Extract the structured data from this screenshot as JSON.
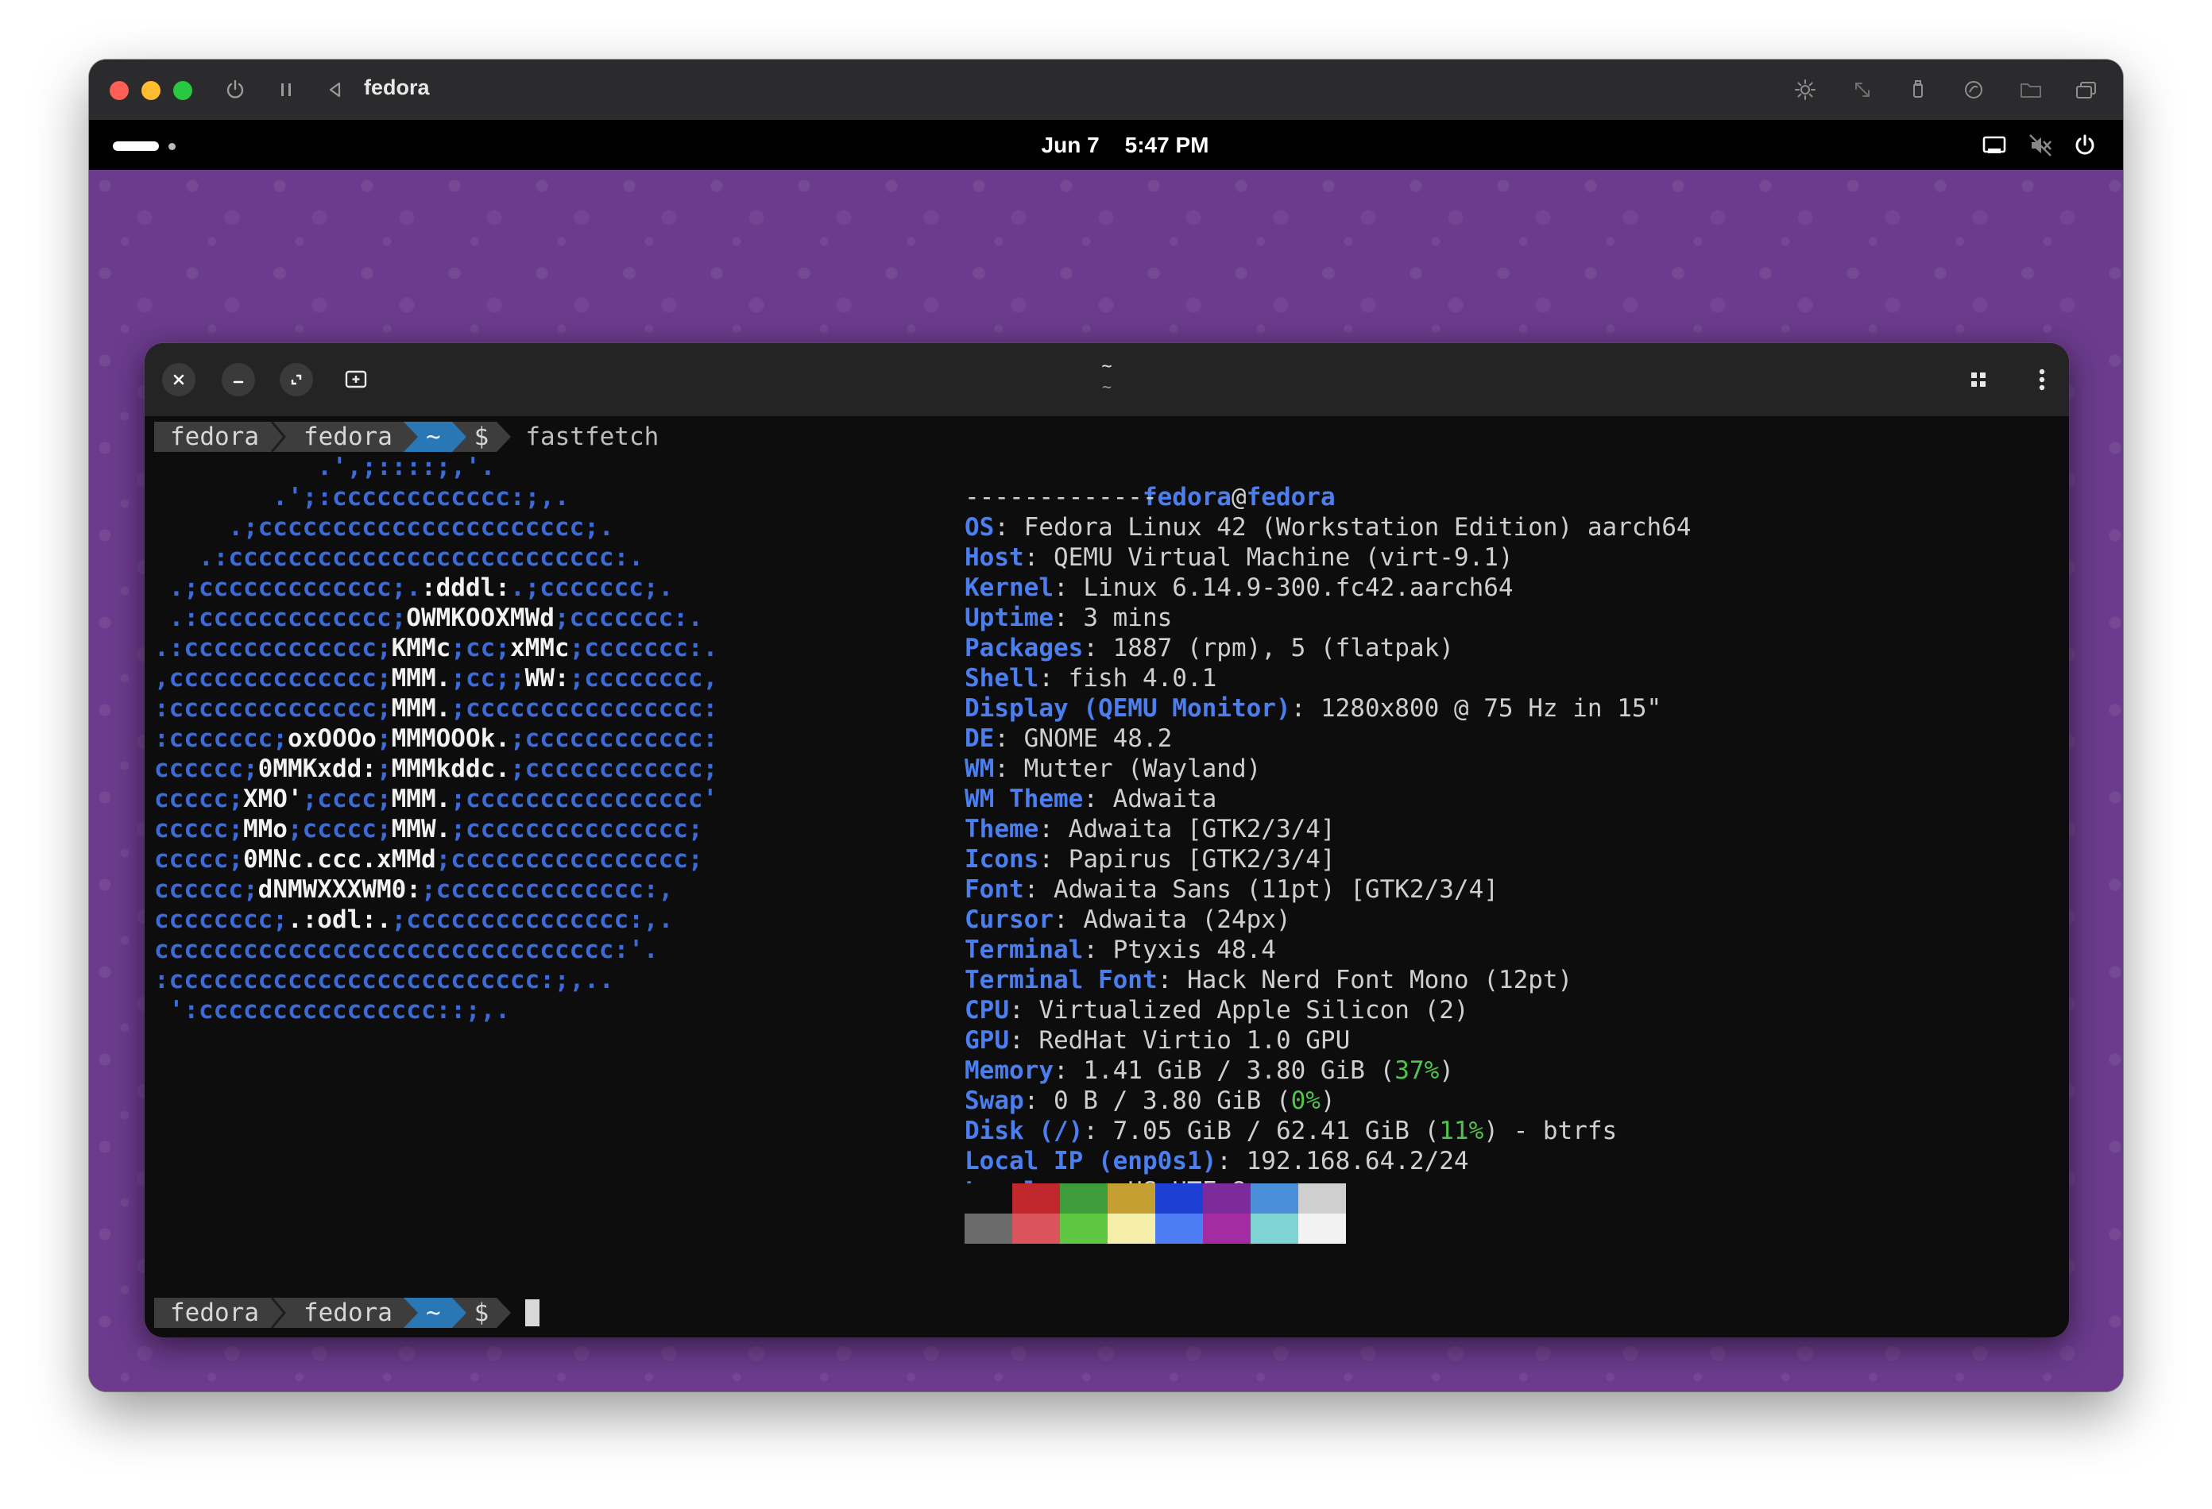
{
  "vm_window": {
    "title": "fedora"
  },
  "topbar": {
    "date": "Jun 7",
    "time": "5:47 PM"
  },
  "terminal": {
    "title": "~",
    "subtitle": "~",
    "prompt": {
      "host": "fedora",
      "user": "fedora",
      "dir": "~",
      "symbol": "$",
      "command": "fastfetch"
    },
    "ascii": [
      "           .',;::::;,'.",
      "        .';:cccccccccccc:;,.",
      "     .;cccccccccccccccccccccc;.",
      "   .:cccccccccccccccccccccccccc:.",
      " .;ccccccccccccc;.:dddl:.;ccccccc;.",
      " .:ccccccccccccc;OWMKOOXMWd;ccccccc:.",
      ".:ccccccccccccc;KMMc;cc;xMMc;ccccccc:.",
      ",cccccccccccccc;MMM.;cc;;WW:;cccccccc,",
      ":cccccccccccccc;MMM.;cccccccccccccccc:",
      ":ccccccc;oxOOOo;MMMOOOk.;cccccccccccc:",
      "cccccc;0MMKxdd:;MMMkddc.;cccccccccccc;",
      "ccccc;XMO';cccc;MMM.;cccccccccccccccc'",
      "ccccc;MMo;ccccc;MMW.;ccccccccccccccc;",
      "ccccc;0MNc.ccc.xMMd;cccccccccccccccc;",
      "cccccc;dNMWXXXWM0:;cccccccccccccc:,",
      "cccccccc;.:odl:.;ccccccccccccccc:,.",
      "ccccccccccccccccccccccccccccccc:'.",
      ":ccccccccccccccccccccccccc:;,..",
      " ':cccccccccccccccc::;,."
    ],
    "ascii_white": [
      [
        "",
        "",
        ""
      ],
      [
        "",
        "",
        ""
      ],
      [
        "",
        "",
        ""
      ],
      [
        "",
        "",
        ""
      ],
      [
        " .;ccccccccccccc;.",
        ":dddl:",
        ".;ccccccc;."
      ],
      [
        " .:ccccccccccccc;",
        "OWMKOOXMWd",
        ";ccccccc:."
      ],
      [
        ".:ccccccccccccc;",
        "KMMc",
        ";cc;",
        "xMMc",
        ";ccccccc:."
      ],
      [
        ",cccccccccccccc;",
        "MMM.",
        ";cc;;",
        "WW:",
        ";cccccccc,"
      ],
      [
        ":cccccccccccccc;",
        "MMM.",
        ";cccccccccccccccc:"
      ],
      [
        ":ccccccc;",
        "oxOOOo",
        ";",
        "MMMOOOk.",
        ";cccccccccccc:"
      ],
      [
        "cccccc;",
        "0MMKxdd:",
        ";",
        "MMMkddc.",
        ";cccccccccccc;"
      ],
      [
        "ccccc;",
        "XMO'",
        ";cccc;",
        "MMM.",
        ";cccccccccccccccc'"
      ],
      [
        "ccccc;",
        "MMo",
        ";ccccc;",
        "MMW.",
        ";ccccccccccccccc;"
      ],
      [
        "ccccc;",
        "0MNc.ccc.xMMd",
        ";cccccccccccccccc;"
      ],
      [
        "cccccc;",
        "dNMWXXXWM0:",
        ";cccccccccccccc:,"
      ],
      [
        "cccccccc;",
        ".:odl:.",
        ";ccccccccccccccc:,."
      ],
      [
        "",
        "",
        ""
      ],
      [
        "",
        "",
        ""
      ],
      [
        "",
        "",
        ""
      ]
    ],
    "info_header_user": "fedora",
    "info_header_at": "@",
    "info_header_host": "fedora",
    "info_separator": "-------------",
    "info": [
      {
        "key": "OS",
        "value": "Fedora Linux 42 (Workstation Edition) aarch64"
      },
      {
        "key": "Host",
        "value": "QEMU Virtual Machine (virt-9.1)"
      },
      {
        "key": "Kernel",
        "value": "Linux 6.14.9-300.fc42.aarch64"
      },
      {
        "key": "Uptime",
        "value": "3 mins"
      },
      {
        "key": "Packages",
        "value": "1887 (rpm), 5 (flatpak)"
      },
      {
        "key": "Shell",
        "value": "fish 4.0.1"
      },
      {
        "key": "Display (QEMU Monitor)",
        "value": "1280x800 @ 75 Hz in 15\""
      },
      {
        "key": "DE",
        "value": "GNOME 48.2"
      },
      {
        "key": "WM",
        "value": "Mutter (Wayland)"
      },
      {
        "key": "WM Theme",
        "value": "Adwaita"
      },
      {
        "key": "Theme",
        "value": "Adwaita [GTK2/3/4]"
      },
      {
        "key": "Icons",
        "value": "Papirus [GTK2/3/4]"
      },
      {
        "key": "Font",
        "value": "Adwaita Sans (11pt) [GTK2/3/4]"
      },
      {
        "key": "Cursor",
        "value": "Adwaita (24px)"
      },
      {
        "key": "Terminal",
        "value": "Ptyxis 48.4"
      },
      {
        "key": "Terminal Font",
        "value": "Hack Nerd Font Mono (12pt)"
      },
      {
        "key": "CPU",
        "value": "Virtualized Apple Silicon (2)"
      },
      {
        "key": "GPU",
        "value": "RedHat Virtio 1.0 GPU"
      },
      {
        "key": "Memory",
        "value": "1.41 GiB / 3.80 GiB (",
        "pct": "37%",
        "after": ")"
      },
      {
        "key": "Swap",
        "value": "0 B / 3.80 GiB (",
        "pct": "0%",
        "after": ")"
      },
      {
        "key": "Disk (/)",
        "value": "7.05 GiB / 62.41 GiB (",
        "pct": "11%",
        "after": ") - btrfs"
      },
      {
        "key": "Local IP (enp0s1)",
        "value": "192.168.64.2/24"
      },
      {
        "key": "Locale",
        "value": "en_US.UTF-8"
      }
    ],
    "palette_top": [
      "#0d0d0d",
      "#c0282d",
      "#3e9d3a",
      "#c4a033",
      "#1d3fd4",
      "#7c2a9c",
      "#4a8fd8",
      "#cfcfcf"
    ],
    "palette_bottom": [
      "#6b6b6b",
      "#d9545c",
      "#5fc642",
      "#f6efa9",
      "#4d7df2",
      "#a32ca3",
      "#7fd3d3",
      "#f2f2f2"
    ]
  },
  "colors": {
    "wallpaper": "#6c3b8d",
    "accent_blue": "#4b7ff0",
    "percent_green": "#52c44d"
  }
}
